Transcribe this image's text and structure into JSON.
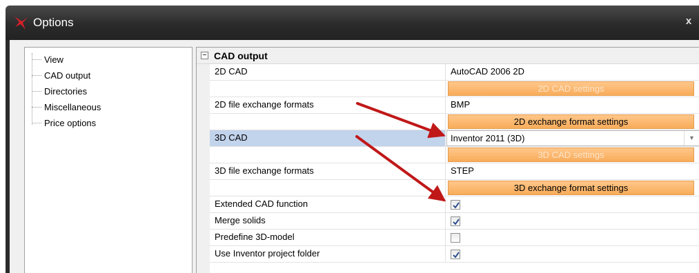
{
  "window": {
    "title": "Options",
    "close_label": "x"
  },
  "tree": {
    "items": [
      {
        "label": "View"
      },
      {
        "label": "CAD output"
      },
      {
        "label": "Directories"
      },
      {
        "label": "Miscellaneous"
      },
      {
        "label": "Price options"
      }
    ]
  },
  "grid": {
    "category": "CAD output",
    "collapse_symbol": "−",
    "rows": {
      "cad2d": {
        "name": "2D CAD",
        "value": "AutoCAD 2006 2D"
      },
      "cad2d_settings": {
        "label": "2D CAD settings",
        "enabled": false
      },
      "fx2d": {
        "name": "2D file exchange formats",
        "value": "BMP"
      },
      "fx2d_settings": {
        "label": "2D exchange format settings",
        "enabled": true
      },
      "cad3d": {
        "name": "3D CAD",
        "value": "Inventor 2011 (3D)",
        "selected": true
      },
      "cad3d_settings": {
        "label": "3D CAD settings",
        "enabled": false
      },
      "fx3d": {
        "name": "3D file exchange formats",
        "value": "STEP"
      },
      "fx3d_settings": {
        "label": "3D exchange format settings",
        "enabled": true
      },
      "extended": {
        "name": "Extended CAD function",
        "checked": true
      },
      "merge": {
        "name": "Merge solids",
        "checked": true
      },
      "predefine": {
        "name": "Predefine 3D-model",
        "checked": false
      },
      "project_folder": {
        "name": "Use Inventor project folder",
        "checked": true
      }
    }
  },
  "colors": {
    "titlebar": "#2b2b2b",
    "selection": "#c2d3ec",
    "button_orange": "#f8ac5a",
    "annotation_arrow": "#c01818"
  }
}
